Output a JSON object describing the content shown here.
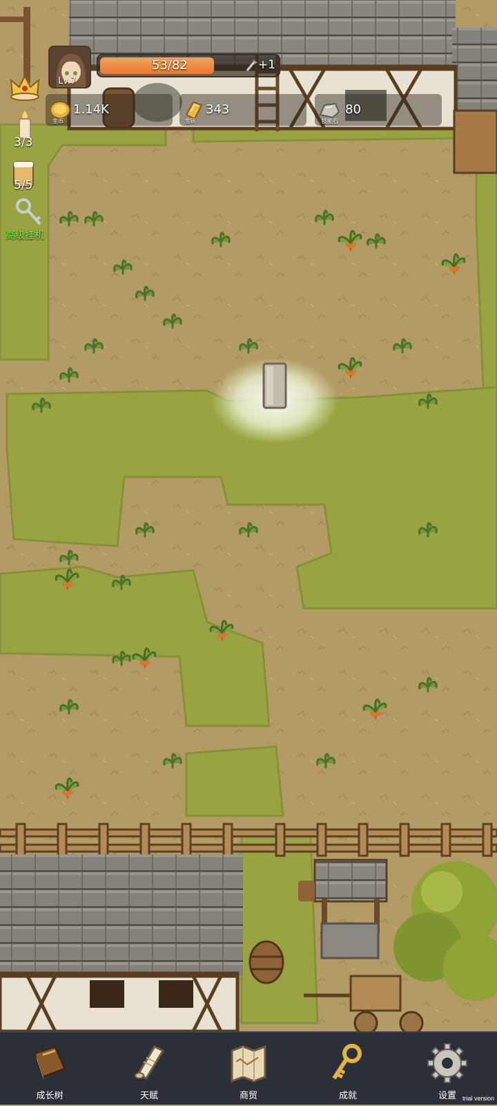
{
  "player": {
    "level_label": "Lv.7",
    "xp_text": "53/82",
    "xp_fraction": 0.646,
    "xp_bonus": "+1"
  },
  "resources": [
    {
      "icon": "gold-coin-icon",
      "value": "1.14K",
      "name": "金币"
    },
    {
      "icon": "gold-bar-icon",
      "value": "343",
      "name": "金砖"
    },
    {
      "icon": "skill-stone-icon",
      "value": "80",
      "name": "技能石"
    }
  ],
  "side": {
    "candle_count": "3/3",
    "beer_count": "5/5",
    "auto_label": "高级挂机"
  },
  "nav": [
    {
      "icon": "book-icon",
      "label": "成长树"
    },
    {
      "icon": "scroll-icon",
      "label": "天赋"
    },
    {
      "icon": "map-icon",
      "label": "商贸"
    },
    {
      "icon": "key-icon",
      "label": "成就"
    },
    {
      "icon": "gear-icon",
      "label": "设置"
    }
  ],
  "watermark": "trial version",
  "colors": {
    "dirt": "#b29c63",
    "grass": "#9aa341",
    "xp_orange": "#e9782f",
    "navbar": "#2b2f38",
    "auto_label_green": "#7cf04a"
  }
}
